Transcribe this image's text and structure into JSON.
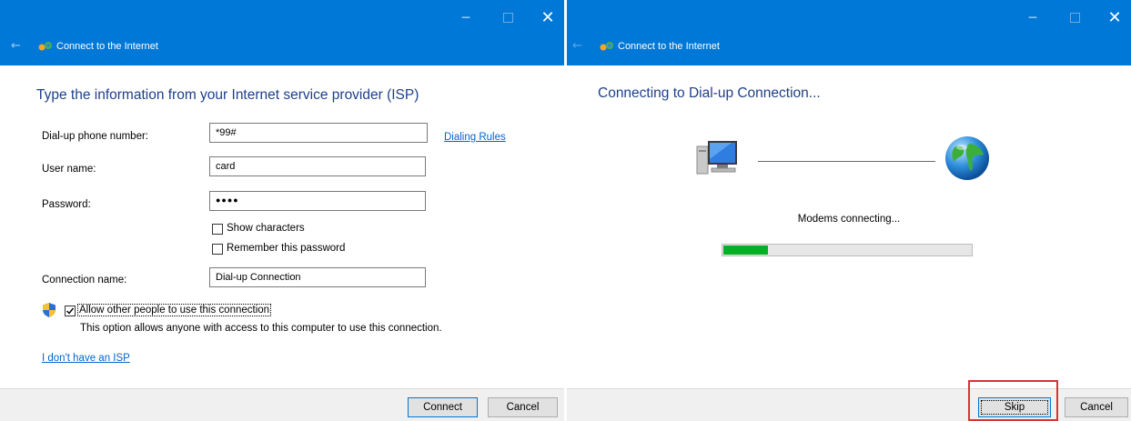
{
  "left_window": {
    "title": "Connect to the Internet",
    "heading": "Type the information from your Internet service provider (ISP)",
    "fields": {
      "phone": {
        "label": "Dial-up phone number:",
        "value": "*99#"
      },
      "username": {
        "label": "User name:",
        "value": "card"
      },
      "password": {
        "label": "Password:",
        "value": "●●●●"
      },
      "connection_name": {
        "label": "Connection name:",
        "value": "Dial-up Connection"
      }
    },
    "dialing_rules_link": "Dialing Rules",
    "show_characters": {
      "label": "Show characters",
      "checked": false
    },
    "remember_password": {
      "label": "Remember this password",
      "checked": false
    },
    "allow_others": {
      "label": "Allow other people to use this connection",
      "checked": true
    },
    "allow_description": "This option allows anyone with access to this computer to use this connection.",
    "no_isp_link": "I don't have an ISP",
    "connect_button": "Connect",
    "cancel_button": "Cancel"
  },
  "right_window": {
    "title": "Connect to the Internet",
    "heading": "Connecting to Dial-up Connection...",
    "status": "Modems connecting...",
    "progress": 0.18,
    "skip_button": "Skip",
    "cancel_button": "Cancel"
  },
  "colors": {
    "titlebar": "#0078d7",
    "heading": "#1e3f8a",
    "link": "#0066cc",
    "progress_fill": "#06b025",
    "highlight": "#d9333a"
  },
  "icons": [
    "minimize-icon",
    "maximize-icon",
    "close-icon",
    "back-arrow-icon",
    "network-connection-icon",
    "uac-shield-icon",
    "computer-icon",
    "globe-icon"
  ]
}
